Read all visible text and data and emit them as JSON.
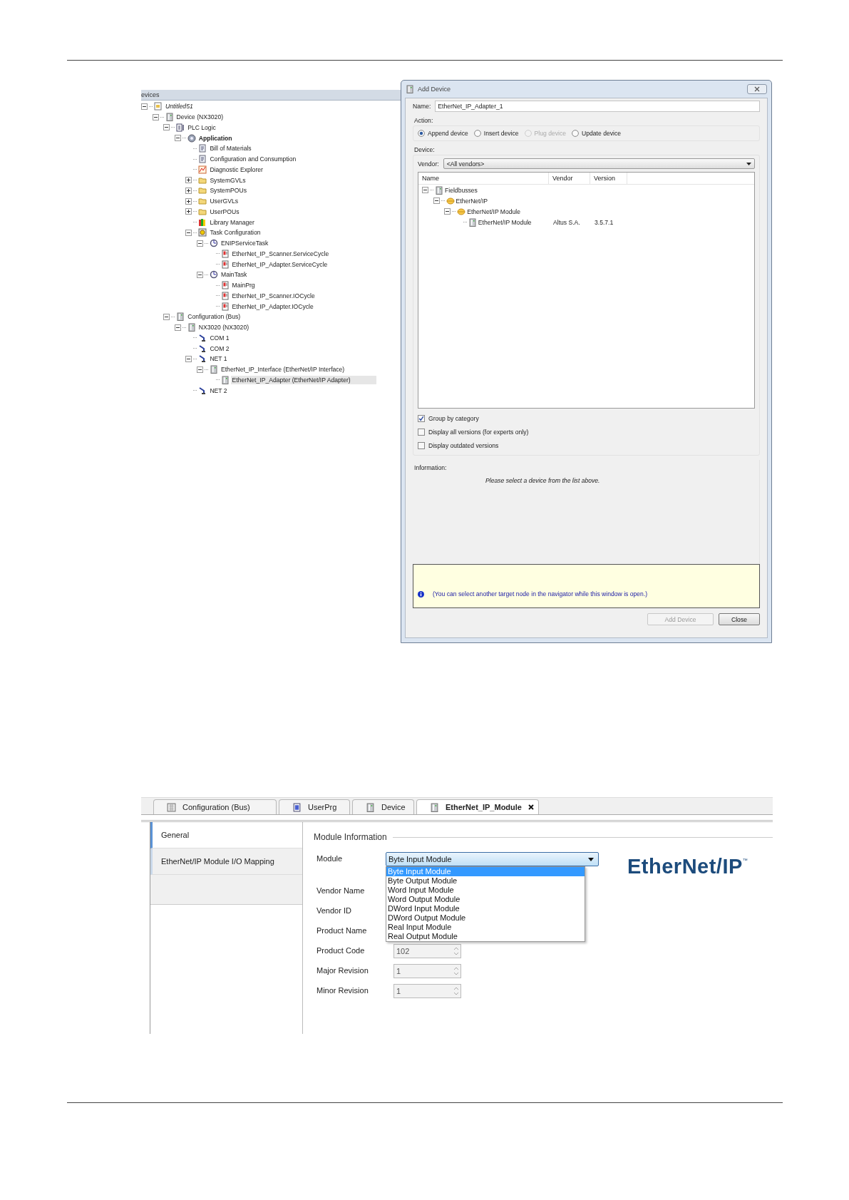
{
  "device_tree": {
    "header": "evices",
    "items": [
      {
        "label": "Untitled51",
        "kind": "project",
        "expanded": true,
        "selected": false,
        "children": [
          {
            "label": "Device (NX3020)",
            "kind": "device",
            "expanded": true,
            "selected": false,
            "children": [
              {
                "label": "PLC Logic",
                "kind": "plc",
                "expanded": true,
                "selected": false,
                "children": [
                  {
                    "label": "Application",
                    "kind": "application",
                    "expanded": true,
                    "selected": false,
                    "active": true,
                    "children": [
                      {
                        "label": "Bill of Materials",
                        "kind": "document",
                        "selected": false
                      },
                      {
                        "label": "Configuration and Consumption",
                        "kind": "document",
                        "selected": false
                      },
                      {
                        "label": "Diagnostic Explorer",
                        "kind": "diagnostic",
                        "selected": false
                      },
                      {
                        "label": "SystemGVLs",
                        "kind": "folder",
                        "expanded": false,
                        "selected": false
                      },
                      {
                        "label": "SystemPOUs",
                        "kind": "folder",
                        "expanded": false,
                        "selected": false
                      },
                      {
                        "label": "UserGVLs",
                        "kind": "folder",
                        "expanded": false,
                        "selected": false
                      },
                      {
                        "label": "UserPOUs",
                        "kind": "folder",
                        "expanded": false,
                        "selected": false
                      },
                      {
                        "label": "Library Manager",
                        "kind": "library",
                        "selected": false
                      },
                      {
                        "label": "Task Configuration",
                        "kind": "tasks",
                        "expanded": true,
                        "selected": false,
                        "children": [
                          {
                            "label": "ENIPServiceTask",
                            "kind": "task",
                            "expanded": true,
                            "selected": false,
                            "children": [
                              {
                                "label": "EtherNet_IP_Scanner.ServiceCycle",
                                "kind": "program",
                                "selected": false
                              },
                              {
                                "label": "EtherNet_IP_Adapter.ServiceCycle",
                                "kind": "program",
                                "selected": false
                              }
                            ]
                          },
                          {
                            "label": "MainTask",
                            "kind": "task",
                            "expanded": true,
                            "selected": false,
                            "children": [
                              {
                                "label": "MainPrg",
                                "kind": "program",
                                "selected": false
                              },
                              {
                                "label": "EtherNet_IP_Scanner.IOCycle",
                                "kind": "program",
                                "selected": false
                              },
                              {
                                "label": "EtherNet_IP_Adapter.IOCycle",
                                "kind": "program",
                                "selected": false
                              }
                            ]
                          }
                        ]
                      }
                    ]
                  }
                ]
              },
              {
                "label": "Configuration (Bus)",
                "kind": "device",
                "expanded": true,
                "selected": false,
                "children": [
                  {
                    "label": "NX3020 (NX3020)",
                    "kind": "device",
                    "expanded": true,
                    "selected": false,
                    "children": [
                      {
                        "label": "COM 1",
                        "kind": "connector",
                        "selected": false
                      },
                      {
                        "label": "COM 2",
                        "kind": "connector",
                        "selected": false
                      },
                      {
                        "label": "NET 1",
                        "kind": "connector",
                        "expanded": true,
                        "selected": false,
                        "children": [
                          {
                            "label": "EtherNet_IP_Interface (EtherNet/IP Interface)",
                            "kind": "device",
                            "expanded": true,
                            "selected": false,
                            "children": [
                              {
                                "label": "EtherNet_IP_Adapter (EtherNet/IP Adapter)",
                                "kind": "device",
                                "selected": true
                              }
                            ]
                          }
                        ]
                      },
                      {
                        "label": "NET 2",
                        "kind": "connector",
                        "selected": false
                      }
                    ]
                  }
                ]
              }
            ]
          }
        ]
      }
    ]
  },
  "add_device_dialog": {
    "title": "Add Device",
    "name_label": "Name:",
    "name_value": "EtherNet_IP_Adapter_1",
    "action_label": "Action:",
    "actions": [
      {
        "label": "Append device",
        "selected": true,
        "disabled": false
      },
      {
        "label": "Insert device",
        "selected": false,
        "disabled": false
      },
      {
        "label": "Plug device",
        "selected": false,
        "disabled": true
      },
      {
        "label": "Update device",
        "selected": false,
        "disabled": false
      }
    ],
    "device_label": "Device:",
    "vendor_label": "Vendor:",
    "vendor_value": "<All vendors>",
    "columns": [
      "Name",
      "Vendor",
      "Version"
    ],
    "devices": [
      {
        "name": "Fieldbusses",
        "kind": "device",
        "expanded": true,
        "children": [
          {
            "name": "EtherNet/IP",
            "kind": "fieldbus",
            "expanded": true,
            "children": [
              {
                "name": "EtherNet/IP Module",
                "kind": "fieldbus",
                "expanded": true,
                "children": [
                  {
                    "name": "EtherNet/IP Module",
                    "kind": "device",
                    "vendor": "Altus S.A.",
                    "version": "3.5.7.1"
                  }
                ]
              }
            ]
          }
        ]
      }
    ],
    "options": [
      {
        "label": "Group by category",
        "checked": true
      },
      {
        "label": "Display all versions (for experts only)",
        "checked": false
      },
      {
        "label": "Display outdated versions",
        "checked": false
      }
    ],
    "information_label": "Information:",
    "information_text": "Please select a device from the list above.",
    "hint": "(You can select another target node in the navigator while this window is open.)",
    "buttons": [
      {
        "label": "Add Device",
        "disabled": true
      },
      {
        "label": "Close",
        "disabled": false
      }
    ]
  },
  "module_editor": {
    "tabs": [
      {
        "label": "Configuration (Bus)",
        "kind": "config",
        "selected": false,
        "closable": false
      },
      {
        "label": "UserPrg",
        "kind": "pou",
        "selected": false,
        "closable": false
      },
      {
        "label": "Device",
        "kind": "device",
        "selected": false,
        "closable": false
      },
      {
        "label": "EtherNet_IP_Module",
        "kind": "device",
        "selected": true,
        "closable": true
      }
    ],
    "nav": [
      {
        "label": "General",
        "selected": true
      },
      {
        "label": "EtherNet/IP Module I/O Mapping",
        "selected": false
      }
    ],
    "section_title": "Module Information",
    "fields": [
      {
        "label": "Module",
        "kind": "dropdown",
        "value": "Byte Input Module"
      },
      {
        "label": "Vendor Name",
        "kind": "hidden"
      },
      {
        "label": "Vendor ID",
        "kind": "hidden"
      },
      {
        "label": "Product Name",
        "kind": "hidden"
      },
      {
        "label": "Product Code",
        "kind": "spin",
        "value": "102"
      },
      {
        "label": "Major Revision",
        "kind": "spin",
        "value": "1"
      },
      {
        "label": "Minor Revision",
        "kind": "spin",
        "value": "1"
      }
    ],
    "dropdown_options": [
      {
        "label": "Byte Input Module",
        "selected": true
      },
      {
        "label": "Byte Output Module",
        "selected": false
      },
      {
        "label": "Word Input Module",
        "selected": false
      },
      {
        "label": "Word Output Module",
        "selected": false
      },
      {
        "label": "DWord Input Module",
        "selected": false
      },
      {
        "label": "DWord Output Module",
        "selected": false
      },
      {
        "label": "Real Input Module",
        "selected": false
      },
      {
        "label": "Real Output Module",
        "selected": false
      }
    ],
    "logo": {
      "text": "EtherNet/IP",
      "mark": "™"
    }
  }
}
